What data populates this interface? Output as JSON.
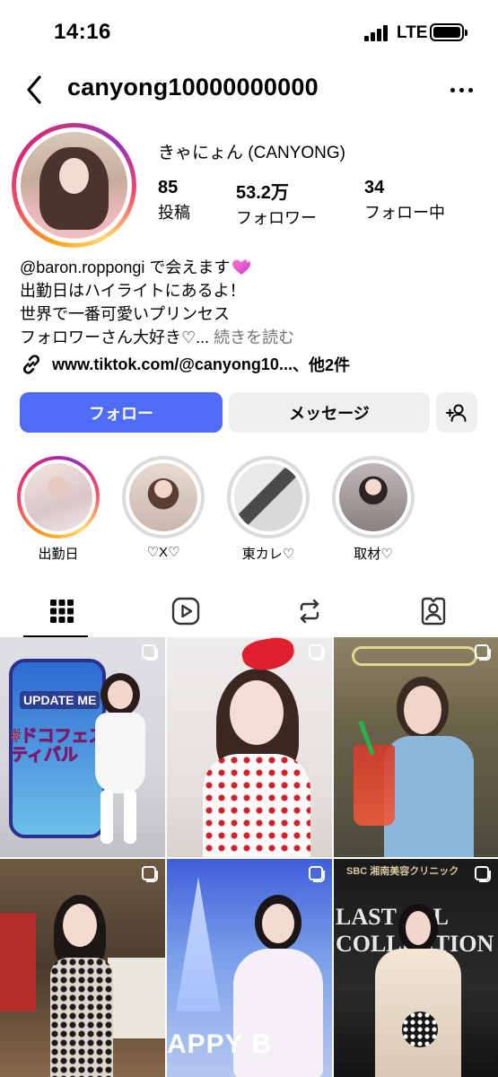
{
  "status_bar": {
    "time": "14:16",
    "network": "LTE"
  },
  "header": {
    "username": "canyong10000000000"
  },
  "profile": {
    "display_name": "きゃにょん (CANYONG)",
    "stats": [
      {
        "value": "85",
        "label": "投稿"
      },
      {
        "value": "53.2万",
        "label": "フォロワー"
      },
      {
        "value": "34",
        "label": "フォロー中"
      }
    ],
    "bio": {
      "mention": "@baron.roppongi",
      "line1_rest": " で会えます",
      "line2": "出勤日はハイライトにあるよ！",
      "line3": "世界で一番可愛いプリンセス",
      "line4": "フォロワーさん大好き♡...",
      "more_label": "続きを読む"
    },
    "link": {
      "text": "www.tiktok.com/@canyong10...",
      "suffix": " 、他2件"
    }
  },
  "buttons": {
    "follow": "フォロー",
    "message": "メッセージ"
  },
  "highlights": [
    {
      "label": "出勤日"
    },
    {
      "label": "♡X♡"
    },
    {
      "label": "東カレ♡"
    },
    {
      "label": "取材♡"
    }
  ],
  "posts": [
    {
      "overlay_1": "UPDATE ME",
      "overlay_2": "#ドコフェスティバル"
    },
    {
      "overlay_1": "",
      "overlay_2": ""
    },
    {
      "overlay_1": "",
      "overlay_2": ""
    },
    {
      "overlay_1": "",
      "overlay_2": ""
    },
    {
      "overlay_1": "APPY B",
      "overlay_2": ""
    },
    {
      "overlay_1": "SBC 湘南美容クリニック",
      "overlay_2": "LAST ALL COLLECTION"
    }
  ],
  "colors": {
    "follow_button": "#4f6cf6",
    "secondary_button": "#efefef",
    "muted_text": "#737373"
  }
}
